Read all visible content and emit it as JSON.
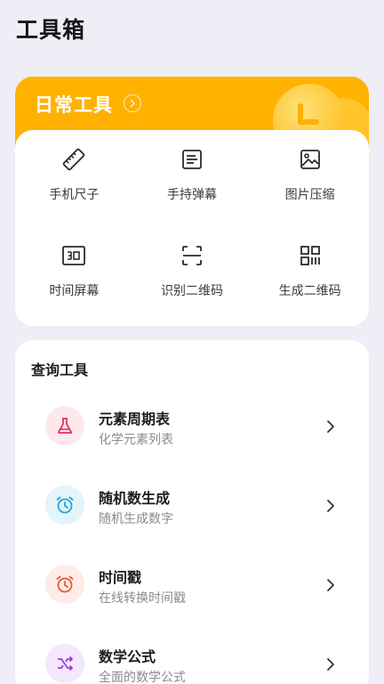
{
  "page": {
    "title": "工具箱"
  },
  "daily": {
    "title": "日常工具",
    "accent_color": "#ffb300",
    "tools": [
      {
        "label": "手机尺子",
        "icon": "ruler-icon"
      },
      {
        "label": "手持弹幕",
        "icon": "text-lines-icon"
      },
      {
        "label": "图片压缩",
        "icon": "image-icon"
      },
      {
        "label": "时间屏幕",
        "icon": "number-screen-icon"
      },
      {
        "label": "识别二维码",
        "icon": "scan-frame-icon"
      },
      {
        "label": "生成二维码",
        "icon": "qr-code-icon"
      }
    ]
  },
  "query": {
    "title": "查询工具",
    "items": [
      {
        "name": "元素周期表",
        "desc": "化学元素列表",
        "icon": "flask-icon",
        "color": "#e0325f",
        "bg": "#fde8ee"
      },
      {
        "name": "随机数生成",
        "desc": "随机生成数字",
        "icon": "alarm-clock-icon",
        "color": "#22a6d6",
        "bg": "#e3f4fb"
      },
      {
        "name": "时间戳",
        "desc": "在线转换时间戳",
        "icon": "alarm-clock-icon",
        "color": "#e8553a",
        "bg": "#fdece7"
      },
      {
        "name": "数学公式",
        "desc": "全面的数学公式",
        "icon": "shuffle-icon",
        "color": "#9b3fd6",
        "bg": "#f3e7fb"
      }
    ]
  }
}
